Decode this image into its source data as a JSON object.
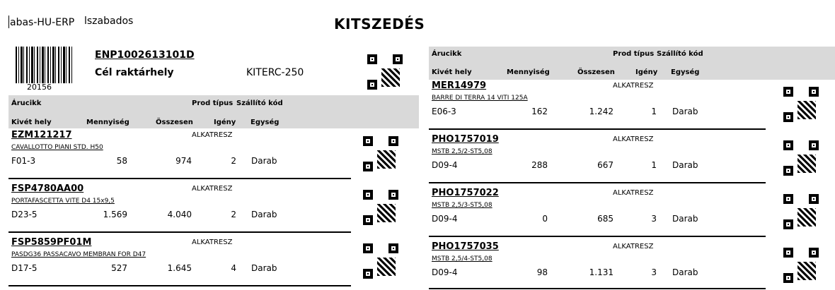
{
  "header": {
    "app": "abas-HU-ERP",
    "user": "lszabados",
    "title": "KITSZEDÉS"
  },
  "document": {
    "barcode_number": "20156",
    "number": "ENP1002613101D",
    "target_label": "Cél raktárhely",
    "target_value": "KITERC-250"
  },
  "columns": {
    "item": "Árucikk",
    "prod_type": "Prod típus",
    "supplier_code": "Szállító kód",
    "location": "Kivét hely",
    "quantity": "Mennyiség",
    "total": "Összesen",
    "demand": "Igény",
    "unit": "Egység"
  },
  "left_rows": [
    {
      "code": "EZM121217",
      "type": "ALKATRESZ",
      "desc": "CAVALLOTTO PIANI STD. H50",
      "location": "F01-3",
      "quantity": "58",
      "total": "974",
      "demand": "2",
      "unit": "Darab"
    },
    {
      "code": "FSP4780AA00",
      "type": "ALKATRESZ",
      "desc": "PORTAFASCETTA VITE D4 15x9,5",
      "location": "D23-5",
      "quantity": "1.569",
      "total": "4.040",
      "demand": "2",
      "unit": "Darab"
    },
    {
      "code": "FSP5859PF01M",
      "type": "ALKATRESZ",
      "desc": "PASDG36 PASSACAVO MEMBRAN FOR D47",
      "location": "D17-5",
      "quantity": "527",
      "total": "1.645",
      "demand": "4",
      "unit": "Darab"
    }
  ],
  "right_rows": [
    {
      "code": "MER14979",
      "type": "ALKATRESZ",
      "desc": "BARRE DI TERRA 14 VITI 125A",
      "location": "E06-3",
      "quantity": "162",
      "total": "1.242",
      "demand": "1",
      "unit": "Darab"
    },
    {
      "code": "PHO1757019",
      "type": "ALKATRESZ",
      "desc": "MSTB 2,5/2-ST5,08",
      "location": "D09-4",
      "quantity": "288",
      "total": "667",
      "demand": "1",
      "unit": "Darab"
    },
    {
      "code": "PHO1757022",
      "type": "ALKATRESZ",
      "desc": "MSTB 2,5/3-ST5,08",
      "location": "D09-4",
      "quantity": "0",
      "total": "685",
      "demand": "3",
      "unit": "Darab"
    },
    {
      "code": "PHO1757035",
      "type": "ALKATRESZ",
      "desc": "MSTB 2,5/4-ST5,08",
      "location": "D09-4",
      "quantity": "98",
      "total": "1.131",
      "demand": "3",
      "unit": "Darab"
    }
  ]
}
